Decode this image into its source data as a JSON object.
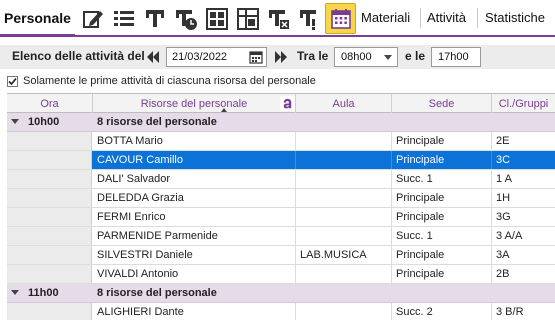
{
  "topbar": {
    "main_tab": "Personale",
    "icons": [
      {
        "name": "edit-icon"
      },
      {
        "name": "list-icon"
      },
      {
        "name": "tree-filter-icon"
      },
      {
        "name": "tree-clock-icon"
      },
      {
        "name": "grid-view-icon"
      },
      {
        "name": "table-view-icon"
      },
      {
        "name": "tree-delete-icon"
      },
      {
        "name": "tree-alert-icon"
      },
      {
        "name": "calendar-icon",
        "active": true
      }
    ],
    "tabs": [
      "Materiali",
      "Attività",
      "Statistiche"
    ]
  },
  "filter": {
    "label": "Elenco delle attività del",
    "date": "21/03/2022",
    "between_label": "Tra le",
    "from": "08h00",
    "and_label": "e le",
    "to": "17h00"
  },
  "checkbox": {
    "checked": true,
    "label": "Solamente le prime attività di ciascuna risorsa del personale"
  },
  "table": {
    "columns": [
      "Ora",
      "Risorse del personale",
      "Aula",
      "Sede",
      "Cl./Gruppi"
    ],
    "groups": [
      {
        "time": "10h00",
        "label": "8 risorse del personale",
        "rows": [
          {
            "name": "BOTTA Mario",
            "room": "",
            "site": "Principale",
            "class": "2E",
            "selected": false
          },
          {
            "name": "CAVOUR Camillo",
            "room": "",
            "site": "Principale",
            "class": "3C",
            "selected": true
          },
          {
            "name": "DALI' Salvador",
            "room": "",
            "site": "Succ. 1",
            "class": "1 A",
            "selected": false
          },
          {
            "name": "DELEDDA Grazia",
            "room": "",
            "site": "Principale",
            "class": "1H",
            "selected": false
          },
          {
            "name": "FERMI Enrico",
            "room": "",
            "site": "Principale",
            "class": "3G",
            "selected": false
          },
          {
            "name": "PARMENIDE Parmenide",
            "room": "",
            "site": "Succ. 1",
            "class": "3 A/A",
            "selected": false
          },
          {
            "name": "SILVESTRI Daniele",
            "room": "LAB.MUSICA",
            "site": "Principale",
            "class": "3A",
            "selected": false
          },
          {
            "name": "VIVALDI Antonio",
            "room": "",
            "site": "Principale",
            "class": "2B",
            "selected": false
          }
        ]
      },
      {
        "time": "11h00",
        "label": "8 risorse del personale",
        "rows": [
          {
            "name": "ALIGHIERI Dante",
            "room": "",
            "site": "Succ. 2",
            "class": "3 B/R",
            "selected": false
          }
        ]
      }
    ]
  },
  "colors": {
    "accent": "#7b3c93",
    "selected_row": "#0b72d7",
    "group_row": "#e6dbe9",
    "active_icon": "#f7d749"
  }
}
